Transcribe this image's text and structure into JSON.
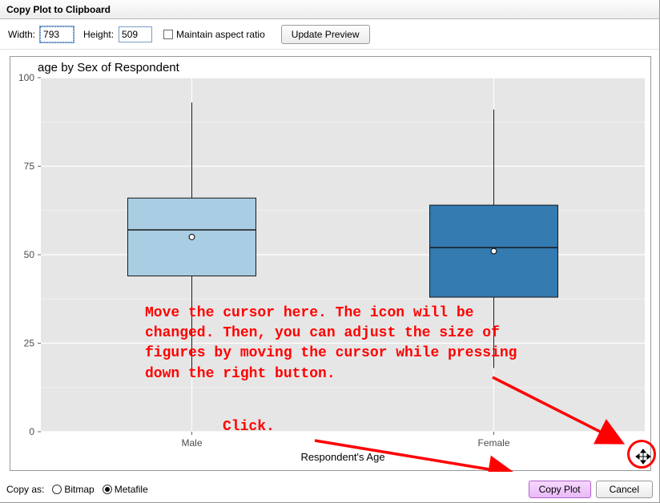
{
  "window": {
    "title": "Copy Plot to Clipboard"
  },
  "toolbar": {
    "width_label": "Width:",
    "width_value": "793",
    "height_label": "Height:",
    "height_value": "509",
    "aspect_label": "Maintain aspect ratio",
    "aspect_checked": false,
    "update_btn": "Update Preview"
  },
  "chart_data": {
    "type": "boxplot",
    "title": "age by Sex of Respondent",
    "xlabel": "Respondent's Age",
    "ylabel": "",
    "ylim": [
      0,
      100
    ],
    "yticks": [
      0,
      25,
      50,
      75,
      100
    ],
    "categories": [
      "Male",
      "Female"
    ],
    "series": [
      {
        "name": "Male",
        "lower_whisker": 18,
        "q1": 44,
        "median": 57,
        "mean": 55,
        "q3": 66,
        "upper_whisker": 93,
        "fill": "#a9cde2"
      },
      {
        "name": "Female",
        "lower_whisker": 18,
        "q1": 38,
        "median": 52,
        "mean": 51,
        "q3": 64,
        "upper_whisker": 91,
        "fill": "#337bb1"
      }
    ]
  },
  "annotations": {
    "instruction": "Move the cursor here. The icon will be\nchanged. Then, you can adjust the size of\nfigures by moving the cursor while pressing\ndown the right button.",
    "click": "Click."
  },
  "footer": {
    "copy_as_label": "Copy as:",
    "radio_bitmap": "Bitmap",
    "radio_metafile": "Metafile",
    "selected": "Metafile",
    "copy_btn": "Copy Plot",
    "cancel_btn": "Cancel"
  }
}
